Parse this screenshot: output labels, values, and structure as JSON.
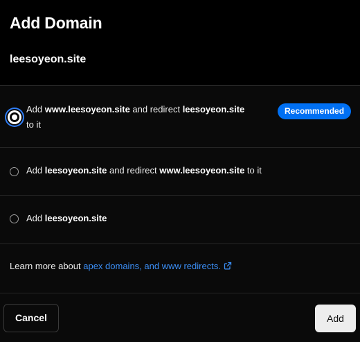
{
  "dialog": {
    "title": "Add Domain",
    "domain": "leesoyeon.site"
  },
  "options": [
    {
      "selected": true,
      "parts": {
        "a": "Add ",
        "b": "www.leesoyeon.site",
        "c": " and redirect ",
        "d": "leesoyeon.site",
        "e": " to it"
      },
      "badge": "Recommended"
    },
    {
      "selected": false,
      "parts": {
        "a": "Add ",
        "b": "leesoyeon.site",
        "c": " and redirect ",
        "d": "www.leesoyeon.site",
        "e": " to it"
      }
    },
    {
      "selected": false,
      "parts": {
        "a": "Add ",
        "b": "leesoyeon.site"
      }
    }
  ],
  "learn_more": {
    "prefix": "Learn more about ",
    "link": "apex domains, and www redirects."
  },
  "footer": {
    "cancel_label": "Cancel",
    "add_label": "Add"
  },
  "colors": {
    "accent": "#0070f3",
    "link": "#3b8ef5",
    "background": "#0a0a0a"
  },
  "icons": {
    "external_link": "external-link-icon"
  }
}
